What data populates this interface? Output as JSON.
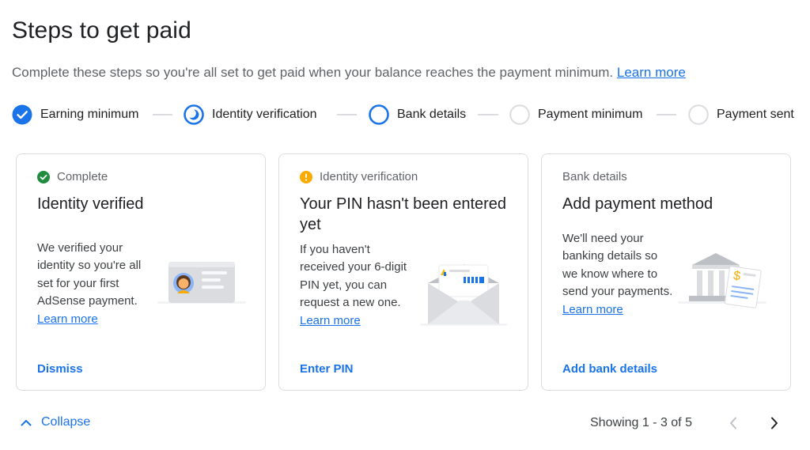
{
  "page": {
    "title": "Steps to get paid",
    "subtitle": "Complete these steps so you're all set to get paid when your balance reaches the payment minimum.",
    "subtitle_link": "Learn more"
  },
  "steps": [
    {
      "label": "Earning minimum",
      "state": "complete"
    },
    {
      "label": "Identity verification",
      "state": "in-progress"
    },
    {
      "label": "Bank details",
      "state": "current"
    },
    {
      "label": "Payment minimum",
      "state": "pending"
    },
    {
      "label": "Payment sent",
      "state": "pending"
    }
  ],
  "cards": [
    {
      "status": "Complete",
      "status_icon": "check-circle-icon",
      "heading": "Identity verified",
      "body": "We verified your identity so you're all set for your first AdSense payment.",
      "link": "Learn more",
      "action": "Dismiss"
    },
    {
      "status": "Identity verification",
      "status_icon": "warning-circle-icon",
      "heading": "Your PIN hasn't been entered yet",
      "body": "If you haven't received your 6-digit PIN yet, you can request a new one.",
      "link": "Learn more",
      "action": "Enter PIN"
    },
    {
      "status": "Bank details",
      "heading": "Add payment method",
      "body": "We'll need your banking details so we know where to send your payments.",
      "link": "Learn more",
      "action": "Add bank details"
    }
  ],
  "footer": {
    "collapse_label": "Collapse",
    "showing": "Showing 1 - 3 of 5"
  },
  "colors": {
    "accent": "#1a73e8",
    "success": "#1e8e3e",
    "warning": "#f9ab00",
    "border": "#dadce0"
  }
}
